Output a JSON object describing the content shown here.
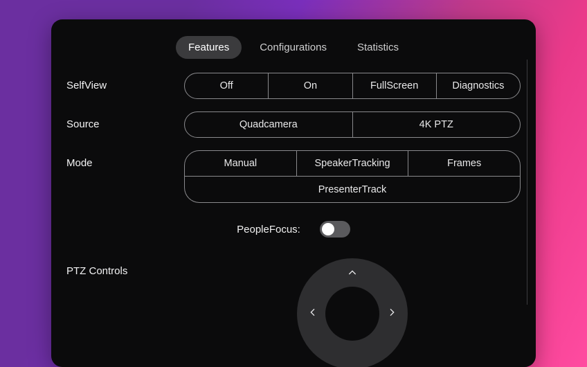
{
  "tabs": {
    "features": "Features",
    "configurations": "Configurations",
    "statistics": "Statistics"
  },
  "labels": {
    "selfview": "SelfView",
    "source": "Source",
    "mode": "Mode",
    "people_focus": "PeopleFocus:",
    "ptz": "PTZ Controls"
  },
  "selfview": {
    "off": "Off",
    "on": "On",
    "fullscreen": "FullScreen",
    "diagnostics": "Diagnostics"
  },
  "source": {
    "quadcamera": "Quadcamera",
    "ptz4k": "4K PTZ"
  },
  "mode": {
    "manual": "Manual",
    "speaker_tracking": "SpeakerTracking",
    "frames": "Frames",
    "presenter_track": "PresenterTrack"
  },
  "people_focus_on": false
}
